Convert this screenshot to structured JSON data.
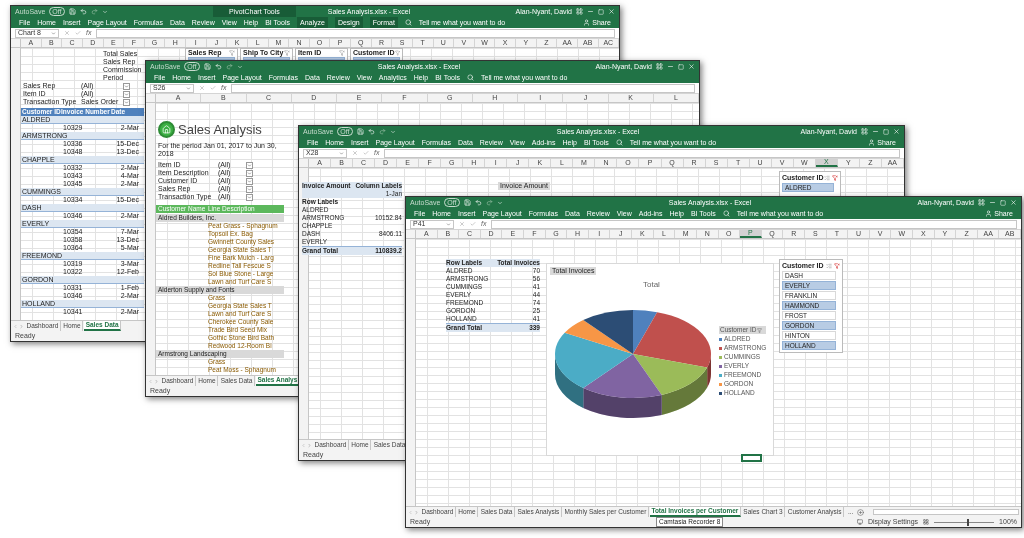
{
  "windows": [
    {
      "kind": "summary",
      "autosave_label": "AutoSave",
      "autosave_state": "Off",
      "context_band": "PivotChart Tools",
      "title": "Sales Analysis.xlsx - Excel",
      "user": "Alan-Nyant, David",
      "ribbon_tabs": [
        "File",
        "Home",
        "Insert",
        "Page Layout",
        "Formulas",
        "Data",
        "Review",
        "View",
        "Help",
        "BI Tools"
      ],
      "context_tabs": [
        "Analyze",
        "Design",
        "Format"
      ],
      "tell_me": "Tell me what you want to do",
      "share": "Share",
      "name_box": "Chart 8",
      "fx": "fx",
      "columns": [
        {
          "label": "A",
          "selected": false
        },
        {
          "label": "B",
          "selected": false
        },
        {
          "label": "C",
          "selected": false
        },
        {
          "label": "D",
          "selected": false
        },
        {
          "label": "E",
          "selected": false
        },
        {
          "label": "F",
          "selected": false
        },
        {
          "label": "G",
          "selected": false
        },
        {
          "label": "H",
          "selected": false
        },
        {
          "label": "I",
          "selected": false
        },
        {
          "label": "J",
          "selected": false
        },
        {
          "label": "K",
          "selected": false
        },
        {
          "label": "L",
          "selected": false
        },
        {
          "label": "M",
          "selected": false
        },
        {
          "label": "N",
          "selected": false
        },
        {
          "label": "O",
          "selected": false
        },
        {
          "label": "P",
          "selected": false
        },
        {
          "label": "Q",
          "selected": false
        },
        {
          "label": "R",
          "selected": false
        },
        {
          "label": "S",
          "selected": false
        },
        {
          "label": "T",
          "selected": false
        },
        {
          "label": "U",
          "selected": false
        },
        {
          "label": "V",
          "selected": false
        },
        {
          "label": "W",
          "selected": false
        },
        {
          "label": "X",
          "selected": false
        },
        {
          "label": "Y",
          "selected": false
        },
        {
          "label": "Z",
          "selected": false
        },
        {
          "label": "AA",
          "selected": false
        },
        {
          "label": "AB",
          "selected": false
        },
        {
          "label": "AC",
          "selected": false
        }
      ],
      "summary_cells": [
        "Total Sales",
        "Sales Rep",
        "Commission",
        "Period"
      ],
      "filters": [
        {
          "label": "Sales Rep",
          "value": "(All)"
        },
        {
          "label": "Item ID",
          "value": "(All)"
        },
        {
          "label": "Transaction Type",
          "value": "Sales Order"
        }
      ],
      "slicers": [
        "Sales Rep",
        "Ship To City",
        "Item ID",
        "Customer ID"
      ],
      "table_header": [
        "Customer ID",
        "Invoice Number",
        "Date"
      ],
      "rows": [
        {
          "kind": "group",
          "label": "ALDRED"
        },
        {
          "kind": "invoice",
          "invoice": "10329",
          "date": "2-Mar"
        },
        {
          "kind": "group",
          "label": "ARMSTRONG"
        },
        {
          "kind": "invoice",
          "invoice": "10336",
          "date": "15-Dec"
        },
        {
          "kind": "invoice",
          "invoice": "10348",
          "date": "13-Dec"
        },
        {
          "kind": "group",
          "label": "CHAPPLE"
        },
        {
          "kind": "invoice",
          "invoice": "10332",
          "date": "2-Mar"
        },
        {
          "kind": "invoice",
          "invoice": "10343",
          "date": "4-Mar"
        },
        {
          "kind": "invoice",
          "invoice": "10345",
          "date": "2-Mar"
        },
        {
          "kind": "group",
          "label": "CUMMINGS"
        },
        {
          "kind": "invoice",
          "invoice": "10334",
          "date": "15-Dec"
        },
        {
          "kind": "group",
          "label": "DASH"
        },
        {
          "kind": "invoice",
          "invoice": "10346",
          "date": "2-Mar"
        },
        {
          "kind": "group",
          "label": "EVERLY"
        },
        {
          "kind": "invoice",
          "invoice": "10354",
          "date": "7-Mar"
        },
        {
          "kind": "invoice",
          "invoice": "10358",
          "date": "13-Dec"
        },
        {
          "kind": "invoice",
          "invoice": "10364",
          "date": "5-Mar"
        },
        {
          "kind": "group",
          "label": "FREEMOND"
        },
        {
          "kind": "invoice",
          "invoice": "10319",
          "date": "3-Mar"
        },
        {
          "kind": "invoice",
          "invoice": "10322",
          "date": "12-Feb"
        },
        {
          "kind": "group",
          "label": "GORDON"
        },
        {
          "kind": "invoice",
          "invoice": "10331",
          "date": "1-Feb"
        },
        {
          "kind": "invoice",
          "invoice": "10346",
          "date": "2-Mar"
        },
        {
          "kind": "group",
          "label": "HOLLAND"
        },
        {
          "kind": "invoice",
          "invoice": "10341",
          "date": "2-Mar"
        }
      ],
      "sheet_tabs": [
        {
          "label": "Dashboard",
          "selected": false
        },
        {
          "label": "Home",
          "selected": false
        },
        {
          "label": "Sales Data",
          "selected": true
        }
      ],
      "status": "Ready"
    },
    {
      "kind": "report",
      "autosave_label": "AutoSave",
      "autosave_state": "Off",
      "title": "Sales Analysis.xlsx - Excel",
      "user": "Alan-Nyant, David",
      "ribbon_tabs": [
        "File",
        "Home",
        "Insert",
        "Page Layout",
        "Formulas",
        "Data",
        "Review",
        "View",
        "Analytics",
        "Help",
        "BI Tools"
      ],
      "tell_me": "Tell me what you want to do",
      "name_box": "S26",
      "fx": "fx",
      "columns": [
        {
          "label": "A",
          "selected": false
        },
        {
          "label": "B",
          "selected": false
        },
        {
          "label": "C",
          "selected": false
        },
        {
          "label": "D",
          "selected": false
        },
        {
          "label": "E",
          "selected": false
        },
        {
          "label": "F",
          "selected": false
        },
        {
          "label": "G",
          "selected": false
        },
        {
          "label": "H",
          "selected": false
        },
        {
          "label": "I",
          "selected": false
        },
        {
          "label": "J",
          "selected": false
        },
        {
          "label": "K",
          "selected": false
        },
        {
          "label": "L",
          "selected": false
        }
      ],
      "report_title": "Sales Analysis",
      "period": "For the period Jan 01, 2017 to Jun 30, 2018",
      "filters": [
        {
          "label": "Item ID",
          "value": "(All)"
        },
        {
          "label": "Item Description",
          "value": "(All)"
        },
        {
          "label": "Customer ID",
          "value": "(All)"
        },
        {
          "label": "Sales Rep",
          "value": "(All)"
        },
        {
          "label": "Transaction Type",
          "value": "(All)"
        }
      ],
      "table_header": [
        "Customer Name",
        "Line Description"
      ],
      "rows": [
        {
          "kind": "group",
          "label": "Aldred Builders, Inc."
        },
        {
          "kind": "line",
          "label": "Peat Grass - Sphagnum"
        },
        {
          "kind": "line",
          "label": "Topsoil Ex. Bag"
        },
        {
          "kind": "line",
          "label": "Gwinnett County Sales"
        },
        {
          "kind": "line",
          "label": "Georgia State Sales T"
        },
        {
          "kind": "line",
          "label": "Fine Bark Mulch - Larg"
        },
        {
          "kind": "line",
          "label": "Redline Tall Fescue S"
        },
        {
          "kind": "line",
          "label": "Sol Blue Stone - Large"
        },
        {
          "kind": "line",
          "label": "Lawn and Turf Care S"
        },
        {
          "kind": "group",
          "label": "Alderton Supply and Fonts"
        },
        {
          "kind": "line",
          "label": "Grass"
        },
        {
          "kind": "line",
          "label": "Georgia State Sales T"
        },
        {
          "kind": "line",
          "label": "Lawn and Turf Care S"
        },
        {
          "kind": "line",
          "label": "Cherokee County Sale"
        },
        {
          "kind": "line",
          "label": "Trade Bird Seed Mix"
        },
        {
          "kind": "line",
          "label": "Gothic Stone Bird Bath"
        },
        {
          "kind": "line",
          "label": "Redwood 12-Room Bi"
        },
        {
          "kind": "group",
          "label": "Armstrong Landscaping"
        },
        {
          "kind": "line",
          "label": "Grass"
        },
        {
          "kind": "line",
          "label": "Peat Moss - Sphagnum"
        }
      ],
      "sheet_tabs": [
        {
          "label": "Dashboard",
          "selected": false
        },
        {
          "label": "Home",
          "selected": false
        },
        {
          "label": "Sales Data",
          "selected": false
        },
        {
          "label": "Sales Analys",
          "selected": true
        }
      ],
      "status": "Ready"
    },
    {
      "kind": "pivot",
      "autosave_label": "AutoSave",
      "autosave_state": "Off",
      "title": "Sales Analysis.xlsx - Excel",
      "user": "Alan-Nyant, David",
      "ribbon_tabs": [
        "File",
        "Home",
        "Insert",
        "Page Layout",
        "Formulas",
        "Data",
        "Review",
        "View",
        "Add-ins",
        "Help",
        "BI Tools"
      ],
      "tell_me": "Tell me what you want to do",
      "share": "Share",
      "name_box": "X28",
      "fx": "fx",
      "columns": [
        {
          "label": "A",
          "selected": false
        },
        {
          "label": "B",
          "selected": false
        },
        {
          "label": "C",
          "selected": false
        },
        {
          "label": "D",
          "selected": false
        },
        {
          "label": "E",
          "selected": false
        },
        {
          "label": "F",
          "selected": false
        },
        {
          "label": "G",
          "selected": false
        },
        {
          "label": "H",
          "selected": false
        },
        {
          "label": "I",
          "selected": false
        },
        {
          "label": "J",
          "selected": false
        },
        {
          "label": "K",
          "selected": false
        },
        {
          "label": "L",
          "selected": false
        },
        {
          "label": "M",
          "selected": false
        },
        {
          "label": "N",
          "selected": false
        },
        {
          "label": "O",
          "selected": false
        },
        {
          "label": "P",
          "selected": false
        },
        {
          "label": "Q",
          "selected": false
        },
        {
          "label": "R",
          "selected": false
        },
        {
          "label": "S",
          "selected": false
        },
        {
          "label": "T",
          "selected": false
        },
        {
          "label": "U",
          "selected": false
        },
        {
          "label": "V",
          "selected": false
        },
        {
          "label": "W",
          "selected": false
        },
        {
          "label": "X",
          "selected": true
        },
        {
          "label": "Y",
          "selected": false
        },
        {
          "label": "Z",
          "selected": false
        },
        {
          "label": "AA",
          "selected": false
        }
      ],
      "pivot": {
        "value_field": "Invoice Amount",
        "column_labels": "Column Labels",
        "column_1": "1-Jan",
        "row_labels": "Row Labels",
        "rows": [
          {
            "label": "ALDRED",
            "value": ""
          },
          {
            "label": "ARMSTRONG",
            "value": "10152.84"
          },
          {
            "label": "CHAPPLE",
            "value": ""
          },
          {
            "label": "DASH",
            "value": "8406.11"
          },
          {
            "label": "EVERLY",
            "value": ""
          }
        ],
        "total_label": "Grand Total",
        "total": "110839.2"
      },
      "field_button": "Invoice Amount",
      "slicer": {
        "title": "Customer ID",
        "items": [
          {
            "label": "ALDRED",
            "selected": true
          }
        ]
      },
      "sheet_tabs": [
        {
          "label": "Dashboard",
          "selected": false
        },
        {
          "label": "Home",
          "selected": false
        },
        {
          "label": "Sales Data",
          "selected": false
        }
      ],
      "status": "Ready"
    },
    {
      "kind": "chart",
      "autosave_label": "AutoSave",
      "autosave_state": "Off",
      "title": "Sales Analysis.xlsx - Excel",
      "user": "Alan-Nyant, David",
      "ribbon_tabs": [
        "File",
        "Home",
        "Insert",
        "Page Layout",
        "Formulas",
        "Data",
        "Review",
        "View",
        "Add-ins",
        "Help",
        "BI Tools"
      ],
      "tell_me": "Tell me what you want to do",
      "share": "Share",
      "name_box": "P41",
      "fx": "fx",
      "columns": [
        {
          "label": "A",
          "selected": false
        },
        {
          "label": "B",
          "selected": false
        },
        {
          "label": "C",
          "selected": false
        },
        {
          "label": "D",
          "selected": false
        },
        {
          "label": "E",
          "selected": false
        },
        {
          "label": "F",
          "selected": false
        },
        {
          "label": "G",
          "selected": false
        },
        {
          "label": "H",
          "selected": false
        },
        {
          "label": "I",
          "selected": false
        },
        {
          "label": "J",
          "selected": false
        },
        {
          "label": "K",
          "selected": false
        },
        {
          "label": "L",
          "selected": false
        },
        {
          "label": "M",
          "selected": false
        },
        {
          "label": "N",
          "selected": false
        },
        {
          "label": "O",
          "selected": false
        },
        {
          "label": "P",
          "selected": true
        },
        {
          "label": "Q",
          "selected": false
        },
        {
          "label": "R",
          "selected": false
        },
        {
          "label": "S",
          "selected": false
        },
        {
          "label": "T",
          "selected": false
        },
        {
          "label": "U",
          "selected": false
        },
        {
          "label": "V",
          "selected": false
        },
        {
          "label": "W",
          "selected": false
        },
        {
          "label": "X",
          "selected": false
        },
        {
          "label": "Y",
          "selected": false
        },
        {
          "label": "Z",
          "selected": false
        },
        {
          "label": "AA",
          "selected": false
        },
        {
          "label": "AB",
          "selected": false
        }
      ],
      "pivot": {
        "row_labels": "Row Labels",
        "value_header": "Total Invoices",
        "rows": [
          {
            "label": "ALDRED",
            "value": "70"
          },
          {
            "label": "ARMSTRONG",
            "value": "56"
          },
          {
            "label": "CUMMINGS",
            "value": "41"
          },
          {
            "label": "EVERLY",
            "value": "44"
          },
          {
            "label": "FREEMOND",
            "value": "74"
          },
          {
            "label": "GORDON",
            "value": "25"
          },
          {
            "label": "HOLLAND",
            "value": "41"
          }
        ],
        "total_label": "Grand Total",
        "total": "339"
      },
      "chart": {
        "field_button": "Total Invoices",
        "title": "Total",
        "legend_button": "Customer ID",
        "legend": [
          {
            "label": "ALDRED",
            "color": "#4f81bd"
          },
          {
            "label": "ARMSTRONG",
            "color": "#c0504d"
          },
          {
            "label": "CUMMINGS",
            "color": "#9bbb59"
          },
          {
            "label": "EVERLY",
            "color": "#8064a2"
          },
          {
            "label": "FREEMOND",
            "color": "#4bacc6"
          },
          {
            "label": "GORDON",
            "color": "#f79646"
          },
          {
            "label": "HOLLAND",
            "color": "#2c4d75"
          }
        ]
      },
      "slicer": {
        "title": "Customer ID",
        "items": [
          {
            "label": "DASH",
            "selected": false
          },
          {
            "label": "EVERLY",
            "selected": true
          },
          {
            "label": "FRANKLIN",
            "selected": false
          },
          {
            "label": "HAMMOND",
            "selected": true
          },
          {
            "label": "FROST",
            "selected": false
          },
          {
            "label": "GORDON",
            "selected": true
          },
          {
            "label": "HINTON",
            "selected": false
          },
          {
            "label": "HOLLAND",
            "selected": true
          }
        ]
      },
      "sheet_tabs": [
        {
          "label": "Dashboard",
          "selected": false
        },
        {
          "label": "Home",
          "selected": false
        },
        {
          "label": "Sales Data",
          "selected": false
        },
        {
          "label": "Sales Analysis",
          "selected": false
        },
        {
          "label": "Monthly Sales per Customer",
          "selected": false
        },
        {
          "label": "Total Invoices per Customer",
          "selected": true
        },
        {
          "label": "Sales Chart 3",
          "selected": false
        },
        {
          "label": "Customer Analysis",
          "selected": false
        }
      ],
      "more_tabs": "...",
      "tooltip": "Camtasia Recorder 8",
      "display_settings": "Display Settings",
      "zoom": {
        "level": 0.55,
        "reading": "100%"
      },
      "status": "Ready"
    }
  ]
}
